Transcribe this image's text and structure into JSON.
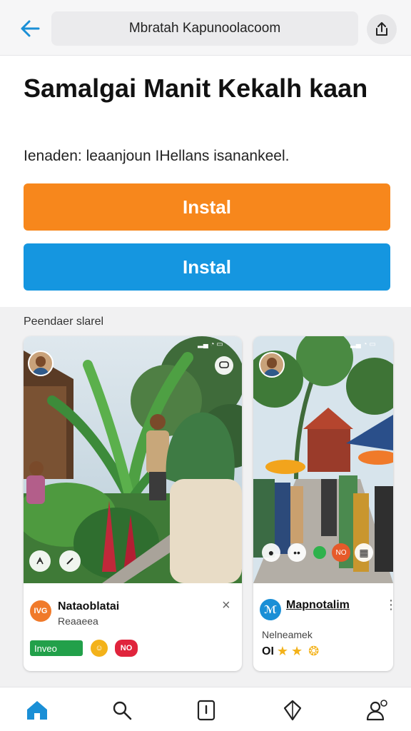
{
  "browser": {
    "url_text": "Mbratah Kapunoolacoom"
  },
  "page": {
    "title": "Samalgai Manit Kekalh kaan",
    "subtitle": "Ienaden: leaanjoun IHellans isanankeel.",
    "install_primary_label": "Instal",
    "install_secondary_label": "Instal",
    "install_primary_color": "#f7871c",
    "install_secondary_color": "#1596e0"
  },
  "section": {
    "label": "Peendaer slarel"
  },
  "cards": [
    {
      "app_icon_text": "IVG",
      "app_icon_color": "#f07a2a",
      "app_name": "Nataoblatai",
      "app_sub": "Reaaeea",
      "tag_label": "Inveo",
      "badge1_text": "☺",
      "badge1_color": "#f3b21a",
      "badge2_text": "NO",
      "badge2_color": "#e0243c",
      "close_glyph": "×"
    },
    {
      "app_icon_text": "ℳ",
      "app_icon_color": "#1a8fd6",
      "app_name": "Mapnotalim",
      "app_sub": "Nelneamek",
      "rating_prefix": "ΟI",
      "rating_stars": "★★",
      "rating_extra": "❂",
      "more_glyph": "⋮"
    }
  ],
  "icons": {
    "back": "arrow-left-icon",
    "share": "share-icon",
    "nav": [
      "home-icon",
      "search-icon",
      "tabs-icon",
      "diamond-icon",
      "profile-icon"
    ]
  }
}
